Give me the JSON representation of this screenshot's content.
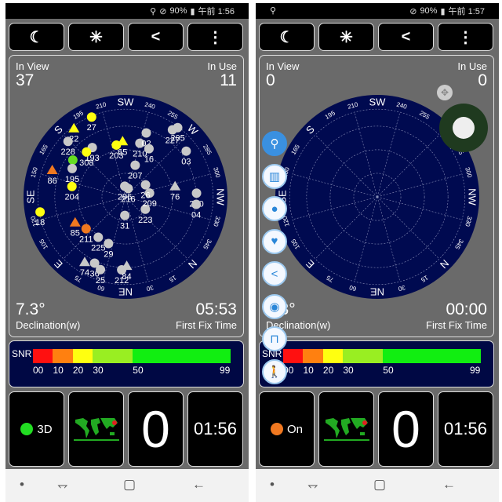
{
  "colors": {
    "plot_bg": "#000a50",
    "yellow": "#ffff10",
    "orange": "#f07820",
    "green": "#66dd22",
    "gray": "#c8c8c8"
  },
  "compass": {
    "rotation_deg": 225,
    "cardinals": {
      "0": "N",
      "45": "NE",
      "90": "E",
      "135": "SE",
      "180": "S",
      "225": "SW",
      "270": "W",
      "315": "NW"
    },
    "degree_labels": [
      15,
      30,
      60,
      75,
      105,
      120,
      150,
      165,
      195,
      210,
      240,
      255,
      285,
      300,
      330,
      345
    ]
  },
  "snr": {
    "label": "SNR",
    "ticks": [
      "00",
      "10",
      "20",
      "30",
      "50",
      "99"
    ],
    "segments": [
      {
        "from": 0,
        "to": 10,
        "color": "#ff1010"
      },
      {
        "from": 10,
        "to": 20,
        "color": "#ff8010"
      },
      {
        "from": 20,
        "to": 30,
        "color": "#ffff10"
      },
      {
        "from": 30,
        "to": 50,
        "color": "#99ee22"
      },
      {
        "from": 50,
        "to": 99,
        "color": "#11ee11"
      }
    ]
  },
  "toolbar": {
    "icons": [
      "moon-icon",
      "sun-icon",
      "share-icon",
      "more-vertical-icon"
    ],
    "glyphs": [
      "☾",
      "✳",
      "<",
      "⋮"
    ]
  },
  "screens": [
    {
      "status": {
        "icons": [
          "location-icon",
          "dnd-icon"
        ],
        "battery": "90%",
        "time": "午前 1:56"
      },
      "in_view_label": "In View",
      "in_view": "37",
      "in_use_label": "In Use",
      "in_use": "11",
      "declination": "7.3°",
      "declination_label": "Declination(w)",
      "fix_time": "05:53",
      "fix_time_label": "First Fix Time",
      "fix_status": {
        "label": "3D",
        "color": "#22dd22"
      },
      "speed": "0",
      "clock": "01:56",
      "satellites": [
        {
          "id": "27",
          "az": 202,
          "el": 1,
          "shape": "circle",
          "color": "yellow"
        },
        {
          "id": "22",
          "az": 188,
          "el": 2,
          "shape": "triangle",
          "color": "yellow"
        },
        {
          "id": "228",
          "az": 179,
          "el": 8,
          "shape": "circle",
          "color": "gray"
        },
        {
          "id": "193",
          "az": 191,
          "el": 29,
          "shape": "circle",
          "color": "gray"
        },
        {
          "id": "308",
          "az": 184,
          "el": 29,
          "shape": "circle",
          "color": "yellow"
        },
        {
          "id": "",
          "az": 170,
          "el": 24,
          "shape": "circle",
          "color": "green"
        },
        {
          "id": "195",
          "az": 163,
          "el": 28,
          "shape": "circle",
          "color": "gray"
        },
        {
          "id": "86",
          "az": 155,
          "el": 10,
          "shape": "triangle",
          "color": "orange"
        },
        {
          "id": "204",
          "az": 146,
          "el": 34,
          "shape": "circle",
          "color": "yellow"
        },
        {
          "id": "18",
          "az": 125,
          "el": 1,
          "shape": "circle",
          "color": "yellow"
        },
        {
          "id": "85",
          "az": 108,
          "el": 32,
          "shape": "triangle",
          "color": "orange"
        },
        {
          "id": "211",
          "az": 96,
          "el": 38,
          "shape": "circle",
          "color": "orange"
        },
        {
          "id": "225",
          "az": 79,
          "el": 40,
          "shape": "circle",
          "color": "gray"
        },
        {
          "id": "29",
          "az": 65,
          "el": 39,
          "shape": "circle",
          "color": "gray"
        },
        {
          "id": "74",
          "az": 77,
          "el": 11,
          "shape": "triangle",
          "color": "gray"
        },
        {
          "id": "36",
          "az": 70,
          "el": 15,
          "shape": "circle",
          "color": "gray"
        },
        {
          "id": "25",
          "az": 64,
          "el": 11,
          "shape": "circle",
          "color": "gray"
        },
        {
          "id": "212",
          "az": 48,
          "el": 15,
          "shape": "circle",
          "color": "gray"
        },
        {
          "id": "84",
          "az": 44,
          "el": 19,
          "shape": "triangle",
          "color": "gray"
        },
        {
          "id": "31",
          "az": 47,
          "el": 71,
          "shape": "circle",
          "color": "gray"
        },
        {
          "id": "223",
          "az": 347,
          "el": 66,
          "shape": "circle",
          "color": "gray"
        },
        {
          "id": "209",
          "az": 306,
          "el": 65,
          "shape": "circle",
          "color": "gray"
        },
        {
          "id": "26",
          "az": 284,
          "el": 66,
          "shape": "circle",
          "color": "gray"
        },
        {
          "id": "206",
          "az": 221,
          "el": 79,
          "shape": "circle",
          "color": "gray"
        },
        {
          "id": "216",
          "az": 243,
          "el": 81,
          "shape": "circle",
          "color": "gray"
        },
        {
          "id": "207",
          "az": 242,
          "el": 56,
          "shape": "circle",
          "color": "gray"
        },
        {
          "id": "203",
          "az": 215,
          "el": 36,
          "shape": "circle",
          "color": "yellow"
        },
        {
          "id": "65",
          "az": 222,
          "el": 33,
          "shape": "triangle",
          "color": "yellow"
        },
        {
          "id": "210",
          "az": 240,
          "el": 33,
          "shape": "circle",
          "color": "gray"
        },
        {
          "id": "02",
          "az": 243,
          "el": 21,
          "shape": "circle",
          "color": "gray"
        },
        {
          "id": "16",
          "az": 251,
          "el": 35,
          "shape": "circle",
          "color": "gray"
        },
        {
          "id": "205",
          "az": 262,
          "el": 1,
          "shape": "circle",
          "color": "gray"
        },
        {
          "id": "227",
          "az": 260,
          "el": 6,
          "shape": "circle",
          "color": "gray"
        },
        {
          "id": "03",
          "az": 278,
          "el": 12,
          "shape": "circle",
          "color": "gray"
        },
        {
          "id": "76",
          "az": 303,
          "el": 38,
          "shape": "triangle",
          "color": "gray"
        },
        {
          "id": "220",
          "az": 312,
          "el": 17,
          "shape": "circle",
          "color": "gray"
        },
        {
          "id": "04",
          "az": 321,
          "el": 17,
          "shape": "circle",
          "color": "gray"
        }
      ]
    },
    {
      "status": {
        "icons": [
          "person-pin-icon",
          "dnd-icon"
        ],
        "battery": "90%",
        "time": "午前 1:57"
      },
      "in_view_label": "In View",
      "in_view": "0",
      "in_use_label": "In Use",
      "in_use": "0",
      "declination": "7.3°",
      "declination_label": "Declination(w)",
      "fix_time": "00:00",
      "fix_time_label": "First Fix Time",
      "fix_status": {
        "label": "On",
        "color": "#f07820"
      },
      "speed": "0",
      "clock": "01:56",
      "satellites": [],
      "floating_menu": [
        {
          "icon": "person-location-icon",
          "glyph": "⚲",
          "active": true
        },
        {
          "icon": "map-icon",
          "glyph": "▥"
        },
        {
          "icon": "pin-icon",
          "glyph": "●"
        },
        {
          "icon": "heart-icon",
          "glyph": "♥"
        },
        {
          "icon": "share-icon",
          "glyph": "<"
        },
        {
          "icon": "eye-icon",
          "glyph": "◉"
        },
        {
          "icon": "lock-icon",
          "glyph": "⊓"
        },
        {
          "icon": "walk-icon",
          "glyph": "🚶"
        }
      ]
    }
  ],
  "nav": {
    "icons": [
      "dot-icon",
      "recent-apps-icon",
      "home-icon",
      "back-icon"
    ],
    "glyphs": [
      "•",
      "⥐",
      "▢",
      "←"
    ]
  }
}
